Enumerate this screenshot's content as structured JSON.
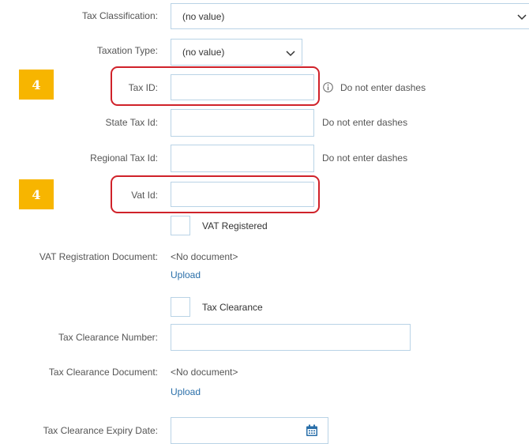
{
  "form": {
    "tax_classification": {
      "label": "Tax Classification:",
      "value": "(no value)"
    },
    "taxation_type": {
      "label": "Taxation Type:",
      "value": "(no value)"
    },
    "tax_id": {
      "label": "Tax ID:",
      "value": "",
      "hint": "Do not enter dashes"
    },
    "state_tax_id": {
      "label": "State Tax Id:",
      "value": "",
      "hint": "Do not enter dashes"
    },
    "regional_tax_id": {
      "label": "Regional Tax Id:",
      "value": "",
      "hint": "Do not enter dashes"
    },
    "vat_id": {
      "label": "Vat Id:",
      "value": ""
    },
    "vat_registered": {
      "label": "VAT Registered",
      "checked": false
    },
    "vat_registration_document": {
      "label": "VAT Registration Document:",
      "value": "<No document>",
      "upload_label": "Upload"
    },
    "tax_clearance": {
      "label": "Tax Clearance",
      "checked": false
    },
    "tax_clearance_number": {
      "label": "Tax Clearance Number:",
      "value": ""
    },
    "tax_clearance_document": {
      "label": "Tax Clearance Document:",
      "value": "<No document>",
      "upload_label": "Upload"
    },
    "tax_clearance_expiry_date": {
      "label": "Tax Clearance Expiry Date:",
      "value": ""
    }
  },
  "annotations": {
    "step_badge_1": "4",
    "step_badge_2": "4"
  },
  "icons": {
    "dropdown": "chevron-down-icon",
    "info": "info-icon",
    "calendar": "calendar-icon"
  },
  "colors": {
    "badge": "#f7b500",
    "highlight": "#d0222a",
    "field_border": "#b9d3e6",
    "link": "#2a6fa9"
  }
}
